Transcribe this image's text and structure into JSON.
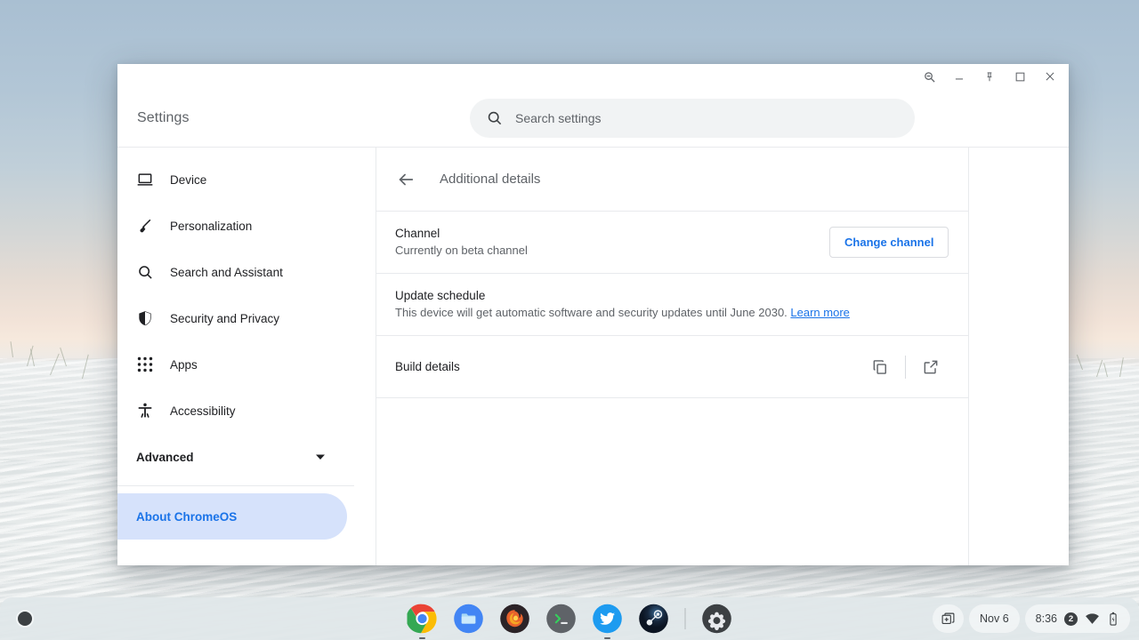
{
  "window": {
    "app_title": "Settings",
    "caption_buttons": [
      {
        "name": "zoom-search-icon",
        "label": "Zoom"
      },
      {
        "name": "minimize-icon",
        "label": "Minimize"
      },
      {
        "name": "pin-icon",
        "label": "Pin"
      },
      {
        "name": "maximize-icon",
        "label": "Maximize"
      },
      {
        "name": "close-icon",
        "label": "Close"
      }
    ]
  },
  "search": {
    "placeholder": "Search settings",
    "value": "",
    "icon": "search-icon"
  },
  "sidebar": {
    "items": [
      {
        "label": "Device",
        "icon": "laptop-icon",
        "selected": false
      },
      {
        "label": "Personalization",
        "icon": "paintbrush-icon",
        "selected": false
      },
      {
        "label": "Search and Assistant",
        "icon": "search-icon",
        "selected": false
      },
      {
        "label": "Security and Privacy",
        "icon": "shield-icon",
        "selected": false
      },
      {
        "label": "Apps",
        "icon": "grid-apps-icon",
        "selected": false
      },
      {
        "label": "Accessibility",
        "icon": "accessibility-person-icon",
        "selected": false
      }
    ],
    "advanced": {
      "label": "Advanced",
      "icon": "chevron-down-icon"
    },
    "about": {
      "label": "About ChromeOS",
      "selected": true
    }
  },
  "content": {
    "back_icon": "back-arrow-icon",
    "title": "Additional details",
    "rows": [
      {
        "title": "Channel",
        "subtitle": "Currently on beta channel",
        "button": "Change channel"
      },
      {
        "title": "Update schedule",
        "subtitle_before": "This device will get automatic software and security updates until June 2030. ",
        "link": "Learn more"
      },
      {
        "title": "Build details",
        "actions": [
          {
            "name": "copy-icon",
            "label": "Copy"
          },
          {
            "name": "open-external-icon",
            "label": "Open"
          }
        ]
      }
    ]
  },
  "shelf": {
    "launcher": {
      "name": "launcher-button",
      "label": "Launcher"
    },
    "apps": [
      {
        "name": "chrome-icon",
        "label": "Chrome",
        "running": true
      },
      {
        "name": "files-icon",
        "label": "Files",
        "running": false
      },
      {
        "name": "firefox-icon",
        "label": "Firefox",
        "running": false
      },
      {
        "name": "terminal-icon",
        "label": "Terminal",
        "running": false
      },
      {
        "name": "twitter-icon",
        "label": "Twitter",
        "running": true
      },
      {
        "name": "steam-icon",
        "label": "Steam",
        "running": false
      },
      {
        "name": "settings-gear-icon",
        "label": "Settings",
        "running": false
      }
    ],
    "status": {
      "desk_icon": "desk-add-icon",
      "date": "Nov 6",
      "time": "8:36",
      "notification_count": "2",
      "wifi_icon": "wifi-icon",
      "battery_icon": "battery-icon"
    }
  },
  "colors": {
    "accent_blue": "#1a73e8",
    "selected_pill": "#d6e2fb",
    "text_primary": "#202124",
    "text_secondary": "#5f6368",
    "divider": "#e8eaed"
  }
}
